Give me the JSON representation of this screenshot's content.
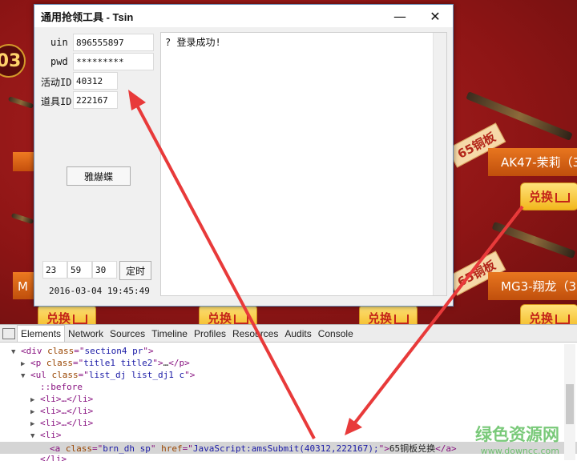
{
  "background": {
    "number_badge": "03",
    "items": [
      {
        "name": "AK47-茉莉（3",
        "price": "65铜板"
      },
      {
        "name": "MG3-翔龙（3",
        "price": "65铜板"
      }
    ],
    "left_partial_name": "M",
    "exchange_label": "兑换"
  },
  "window": {
    "title": "通用抢领工具 - Tsin",
    "minimize_glyph": "—",
    "close_glyph": "✕",
    "fields": {
      "uin_label": "uin",
      "uin_value": "896555897",
      "pwd_label": "pwd",
      "pwd_value": "*********",
      "activity_label": "活动ID",
      "activity_value": "40312",
      "item_label": "道具ID",
      "item_value": "222167"
    },
    "action_button": "雅爀蝶",
    "timer": {
      "hour": "23",
      "minute": "59",
      "second": "30",
      "button": "定时"
    },
    "datetime": "2016-03-04 19:45:49",
    "log_text": "? 登录成功!"
  },
  "devtools": {
    "tabs": [
      "Elements",
      "Network",
      "Sources",
      "Timeline",
      "Profiles",
      "Resources",
      "Audits",
      "Console"
    ],
    "active_tab": "Elements",
    "tree": {
      "div_class": "section4 pr",
      "p_class": "title1 title2",
      "ul_class": "list_dj list_dj1 c",
      "before": "::before",
      "li_collapsed": "<li>…</li>",
      "li_open": "<li>",
      "a_class": "brn_dh sp",
      "a_href": "JavaScript:amsSubmit(40312,222167);",
      "a_text": "65铜板兑换",
      "li_close": "</li>"
    },
    "watermark": {
      "title": "绿色资源网",
      "url": "www.downcc.com"
    }
  },
  "colors": {
    "arrow": "#e83a3a",
    "selection": "#d5d5d5",
    "tag": "#881280",
    "attr_name": "#994500",
    "attr_value": "#1a1aa6"
  }
}
